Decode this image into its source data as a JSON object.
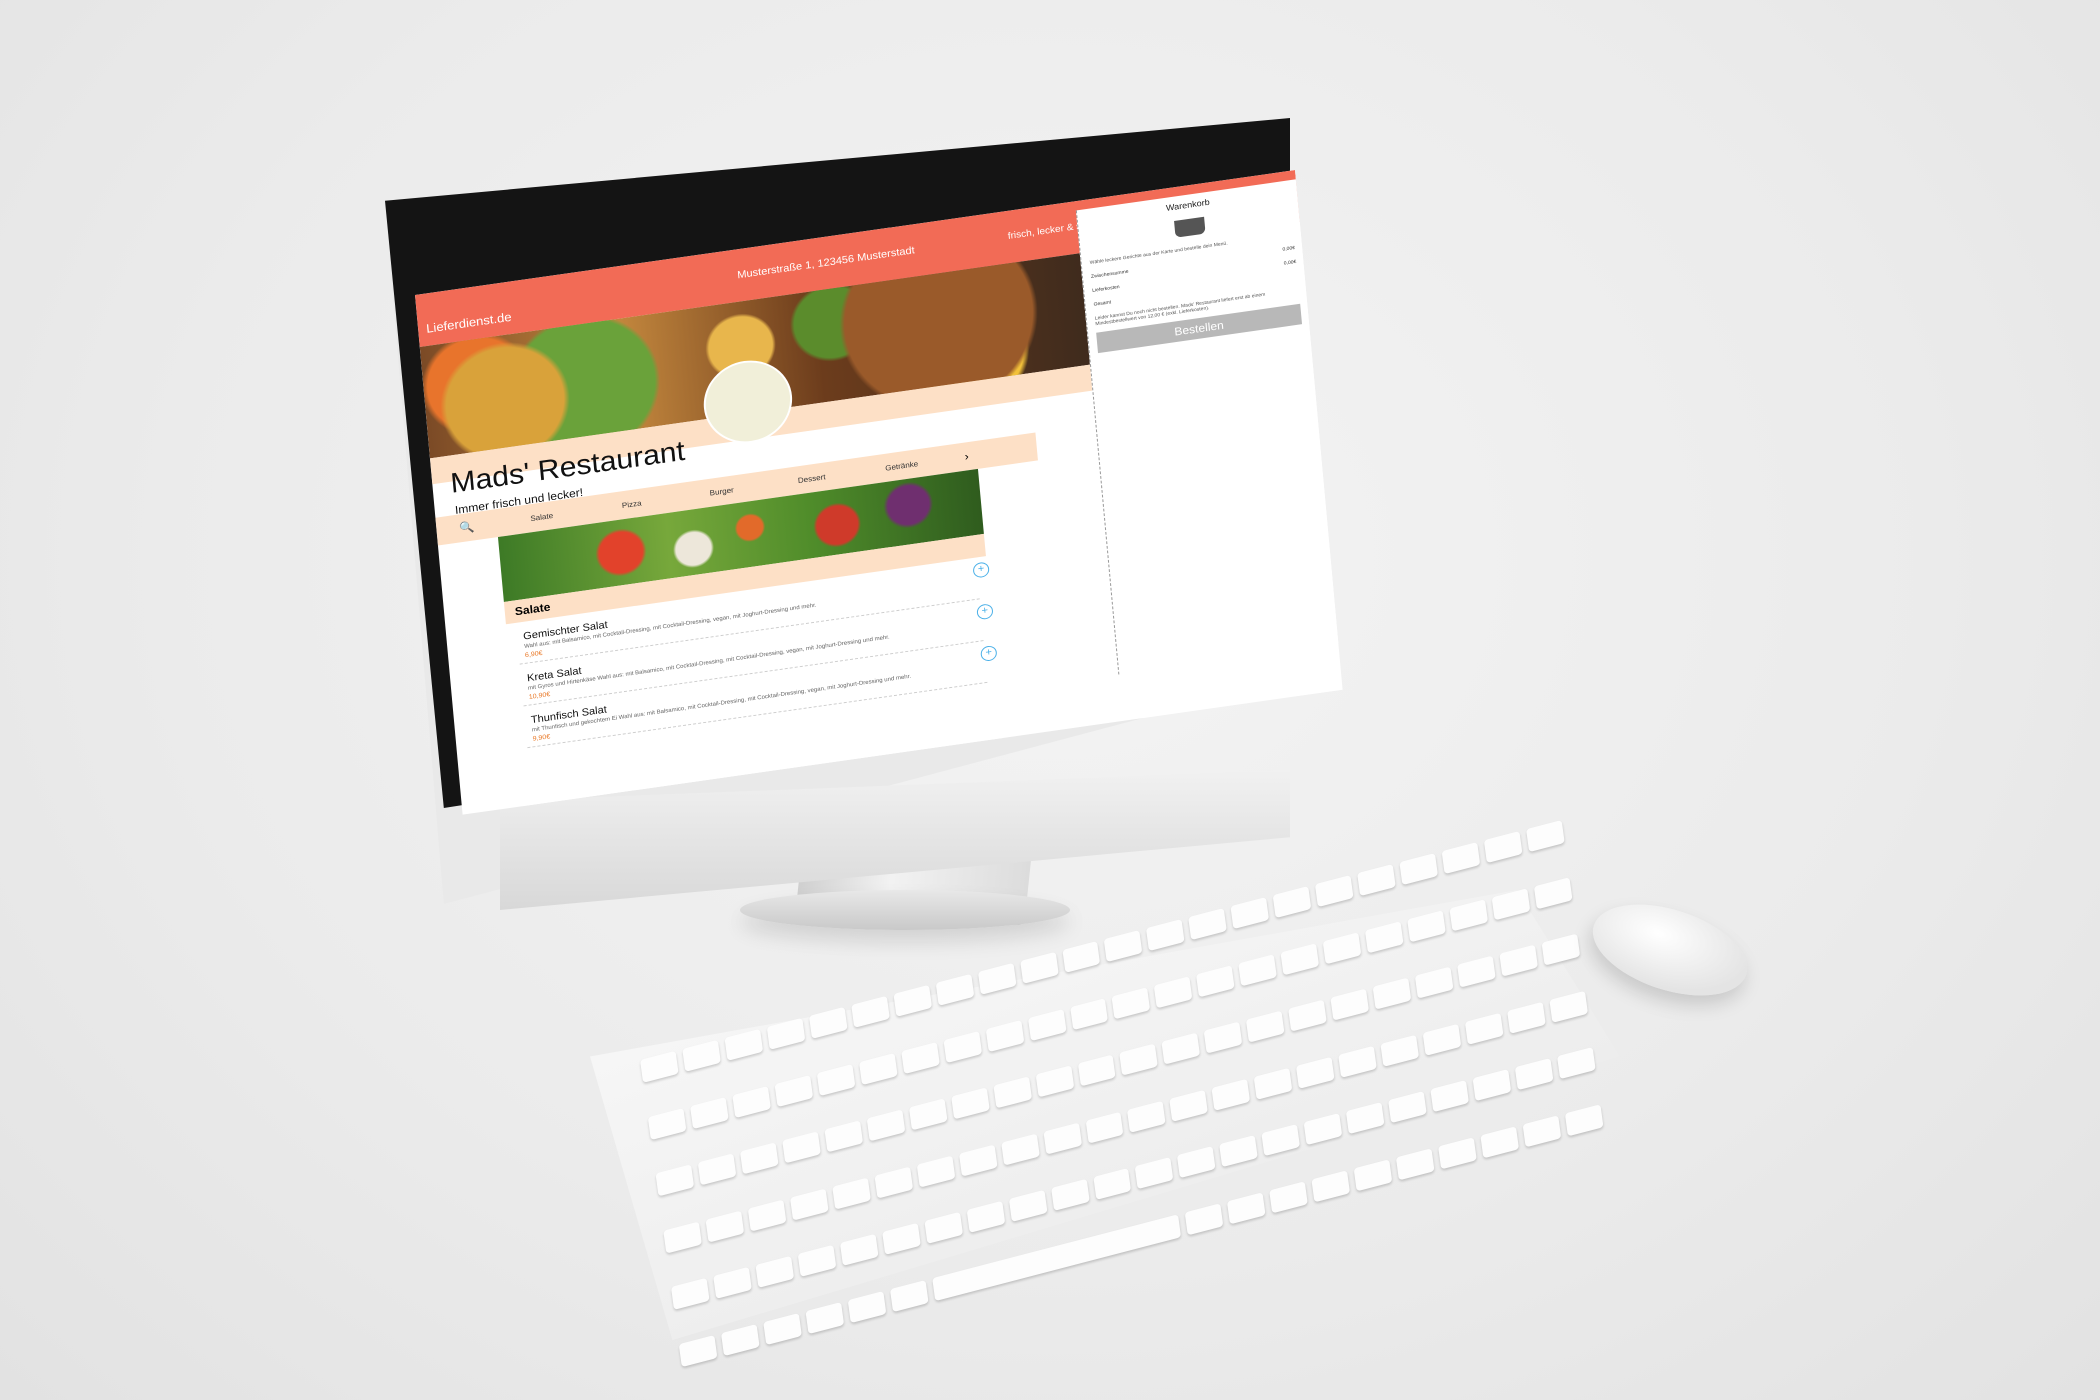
{
  "site": {
    "logo": "Lieferdienst.de",
    "address": "Musterstraße 1, 123456 Musterstadt",
    "slogan": "frisch, lecker & schnell"
  },
  "restaurant": {
    "name": "Mads' Restaurant",
    "tagline": "Immer frisch und lecker!"
  },
  "nav": {
    "search_icon": "search-icon",
    "categories": [
      "Salate",
      "Pizza",
      "Burger",
      "Dessert",
      "Getränke"
    ],
    "next_icon": "chevron-right-icon",
    "next_glyph": "›"
  },
  "menu": {
    "section": "Salate",
    "items": [
      {
        "name": "Gemischter Salat",
        "description": "Wahl aus: mit Balsamico, mit Cocktail-Dressing, mit Cocktail-Dressing, vegan, mit Joghurt-Dressing und mehr.",
        "price": "6,90€"
      },
      {
        "name": "Kreta Salat",
        "description": "mit Gyros und Hirtenkäse Wahl aus: mit Balsamico, mit Cocktail-Dressing, mit Cocktail-Dressing, vegan, mit Joghurt-Dressing und mehr.",
        "price": "10,90€"
      },
      {
        "name": "Thunfisch Salat",
        "description": "mit Thunfisch und gekochtem Ei Wahl aus: mit Balsamico, mit Cocktail-Dressing, mit Cocktail-Dressing, vegan, mit Joghurt-Dressing und mehr.",
        "price": "9,90€"
      }
    ]
  },
  "cart": {
    "title": "Warenkorb",
    "empty_hint": "Wähle leckere Gerichte aus der Karte und bestelle dein Menü.",
    "rows": [
      {
        "label": "Zwischensumme",
        "value": "0,00€"
      },
      {
        "label": "Lieferkosten",
        "value": "0,00€"
      }
    ],
    "total_label": "Gesamt",
    "note": "Leider kannst Du noch nicht bestellen. Mads' Restaurant liefert erst ab einem Mindestbestellwert von 12,00 € (exkl. Lieferkosten).",
    "order_button": "Bestellen"
  },
  "colors": {
    "accent": "#f26b56",
    "light_accent": "#fde0c6",
    "price": "#e97826",
    "add_icon": "#4ab0e8"
  }
}
